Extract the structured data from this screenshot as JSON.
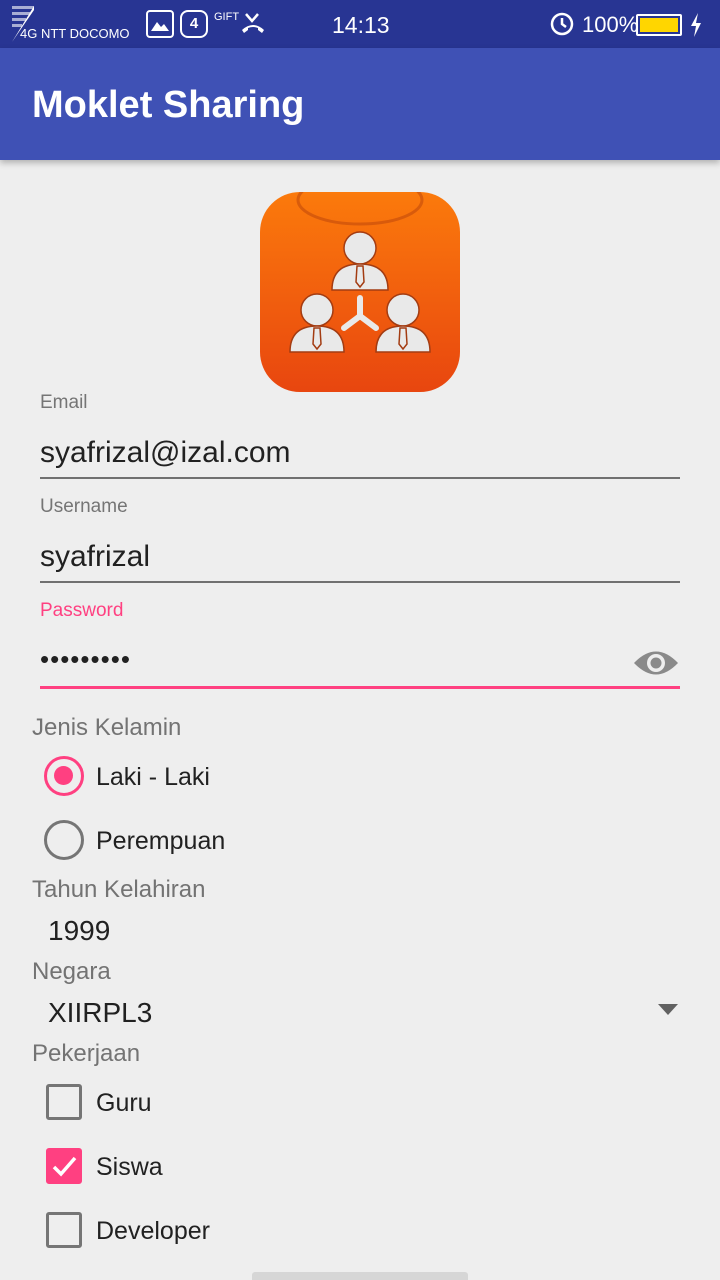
{
  "status_bar": {
    "carrier": "4G NTT DOCOMO",
    "notification_count": "4",
    "gift_label": "GIFT",
    "time": "14:13",
    "battery": "100%",
    "battery_level": 1.0,
    "icons": [
      "signal-icon",
      "image-icon",
      "gift-icon",
      "missed-call-icon",
      "alarm-clock-icon",
      "battery-icon",
      "charging-icon"
    ]
  },
  "app_bar": {
    "title": "Moklet Sharing"
  },
  "form": {
    "email": {
      "label": "Email",
      "value": "syafrizal@izal.com"
    },
    "username": {
      "label": "Username",
      "value": "syafrizal"
    },
    "password": {
      "label": "Password",
      "value": "•••••••••",
      "icon": "eye-icon"
    },
    "gender": {
      "label": "Jenis Kelamin",
      "options": [
        {
          "label": "Laki - Laki",
          "checked": true
        },
        {
          "label": "Perempuan",
          "checked": false
        }
      ]
    },
    "birth_year": {
      "label": "Tahun Kelahiran",
      "value": "1999"
    },
    "country": {
      "label": "Negara",
      "value": "XIIRPL3"
    },
    "job": {
      "label": "Pekerjaan",
      "options": [
        {
          "label": "Guru",
          "checked": false
        },
        {
          "label": "Siswa",
          "checked": true
        },
        {
          "label": "Developer",
          "checked": false
        }
      ]
    }
  },
  "colors": {
    "status_bar": "#283593",
    "app_bar": "#3f51b5",
    "accent": "#ff4081",
    "background": "#eeeeee",
    "logo_top": "#fb7a0c",
    "logo_bottom": "#e8460f"
  }
}
